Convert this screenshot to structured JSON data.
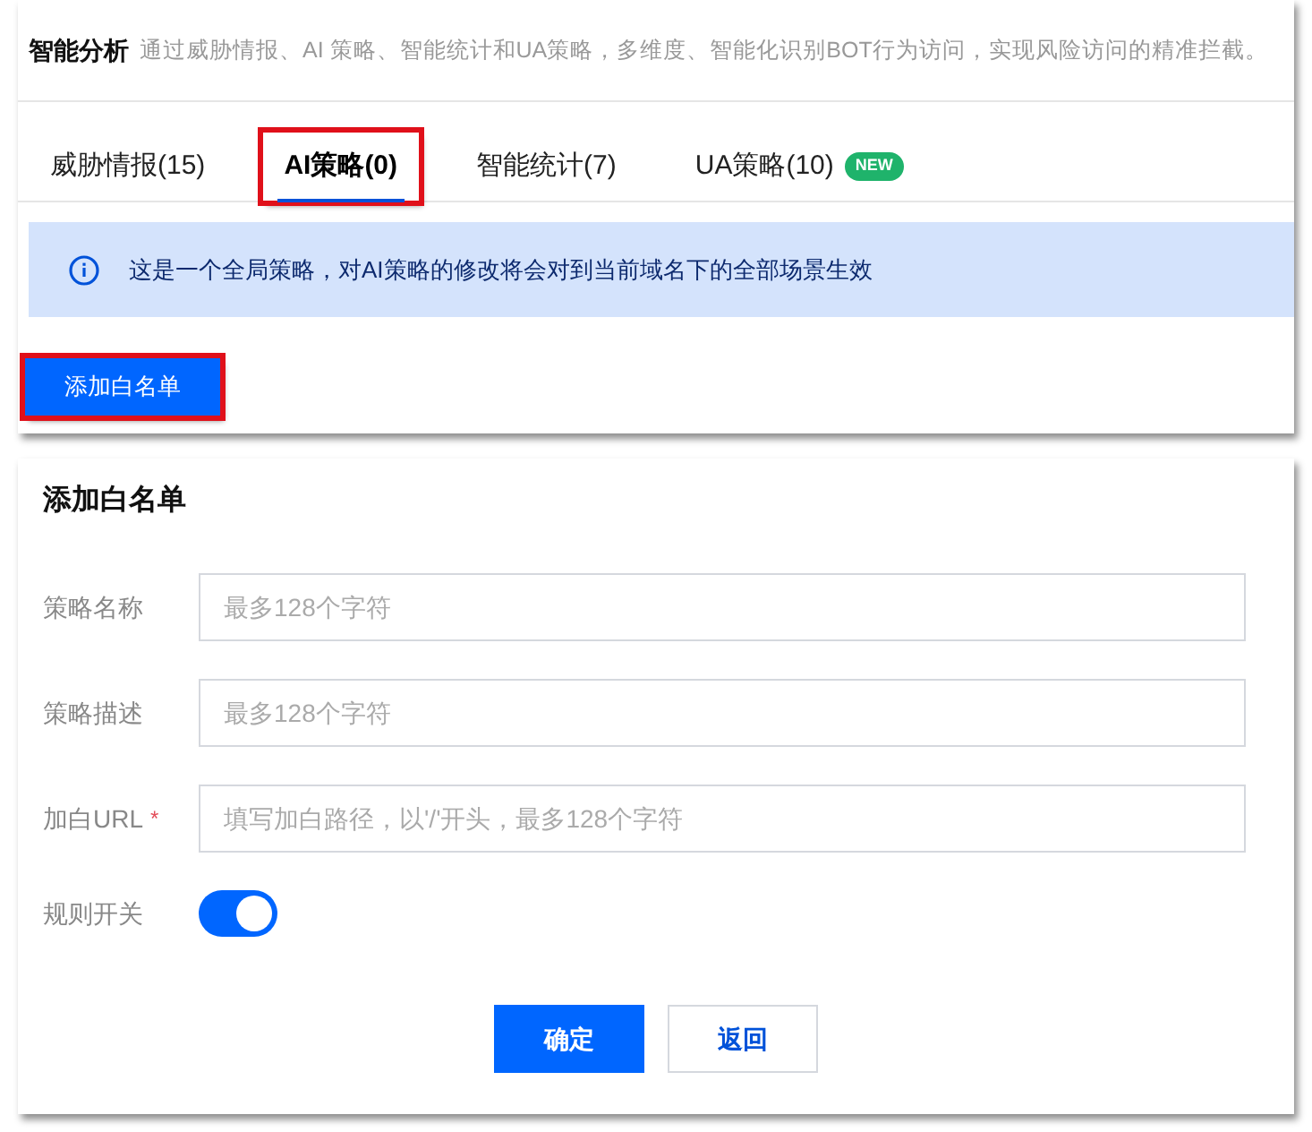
{
  "header": {
    "title": "智能分析",
    "description": "通过威胁情报、AI 策略、智能统计和UA策略，多维度、智能化识别BOT行为访问，实现风险访问的精准拦截。"
  },
  "tabs": [
    {
      "label": "威胁情报(15)",
      "selected": false,
      "annotated": false
    },
    {
      "label": "AI策略(0)",
      "selected": true,
      "annotated": true
    },
    {
      "label": "智能统计(7)",
      "selected": false,
      "annotated": false
    },
    {
      "label": "UA策略(10)",
      "selected": false,
      "annotated": false,
      "badge": "NEW"
    }
  ],
  "alert": {
    "text": "这是一个全局策略，对AI策略的修改将会对到当前域名下的全部场景生效"
  },
  "add_button": {
    "label": "添加白名单",
    "annotated": true
  },
  "dialog": {
    "title": "添加白名单",
    "fields": [
      {
        "kind": "text",
        "label": "策略名称",
        "placeholder": "最多128个字符"
      },
      {
        "kind": "text",
        "label": "策略描述",
        "placeholder": "最多128个字符"
      },
      {
        "kind": "text",
        "label": "加白URL",
        "placeholder": "填写加白路径，以'/'开头，最多128个字符",
        "required_mark": "*"
      },
      {
        "kind": "switch",
        "label": "规则开关",
        "on": true
      }
    ],
    "buttons": [
      {
        "label": "确定",
        "kind": "primary"
      },
      {
        "label": "返回",
        "kind": "secondary"
      }
    ]
  }
}
